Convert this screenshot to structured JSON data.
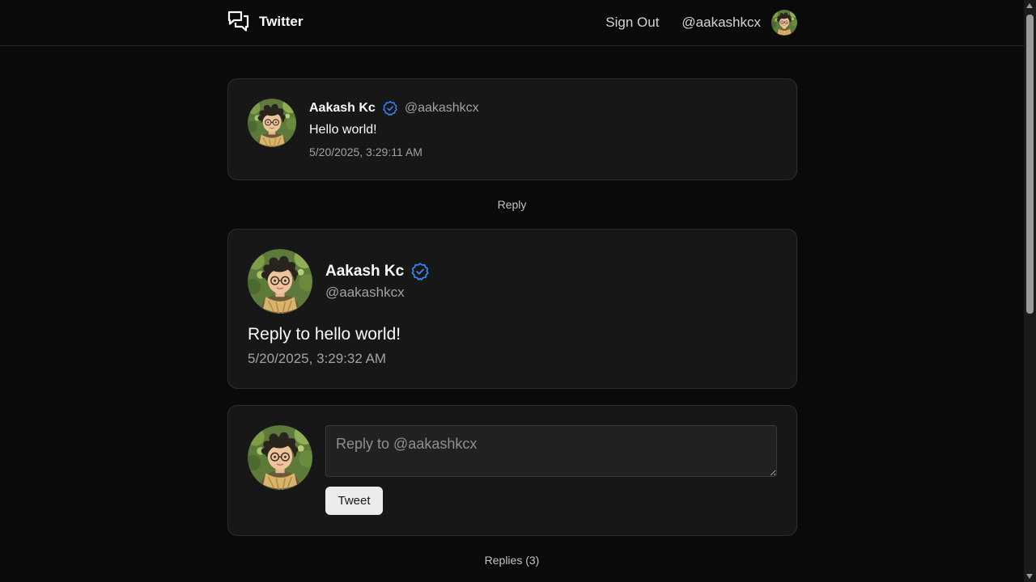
{
  "navbar": {
    "brand": "Twitter",
    "brand_icon": "chat-bubbles-icon",
    "sign_out": "Sign Out",
    "user_handle": "@aakashkcx"
  },
  "parent_tweet": {
    "author_name": "Aakash Kc",
    "author_handle": "@aakashkcx",
    "verified_icon": "verified-badge-icon",
    "content": "Hello world!",
    "timestamp": "5/20/2025, 3:29:11 AM"
  },
  "reply_label": "Reply",
  "main_tweet": {
    "author_name": "Aakash Kc",
    "author_handle": "@aakashkcx",
    "verified_icon": "verified-badge-icon",
    "content": "Reply to hello world!",
    "timestamp": "5/20/2025, 3:29:32 AM"
  },
  "composer": {
    "placeholder": "Reply to @aakashkcx",
    "value": "",
    "submit_label": "Tweet"
  },
  "replies_label": "Replies (3)",
  "colors": {
    "background": "#0a0a0a",
    "card": "#171717",
    "border": "#2e2e2e",
    "verified": "#3b82f6",
    "muted_text": "#a3a3a3"
  }
}
